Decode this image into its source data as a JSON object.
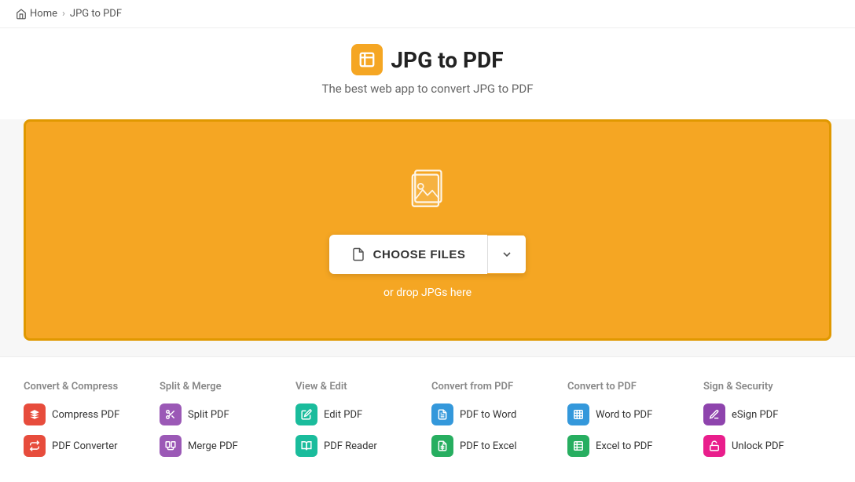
{
  "breadcrumb": {
    "home_label": "Home",
    "separator": "›",
    "current": "JPG to PDF"
  },
  "hero": {
    "title": "JPG to PDF",
    "subtitle": "The best web app to convert JPG to PDF",
    "app_icon": "⊞"
  },
  "dropzone": {
    "choose_files_label": "CHOOSE FILES",
    "drop_hint": "or drop JPGs here"
  },
  "tools": {
    "categories": [
      {
        "id": "convert-compress",
        "title": "Convert & Compress",
        "items": [
          {
            "id": "compress-pdf",
            "label": "Compress PDF",
            "icon_color": "icon-red",
            "icon": "🗜"
          },
          {
            "id": "pdf-converter",
            "label": "PDF Converter",
            "icon_color": "icon-red",
            "icon": "⇄"
          }
        ]
      },
      {
        "id": "split-merge",
        "title": "Split & Merge",
        "items": [
          {
            "id": "split-pdf",
            "label": "Split PDF",
            "icon_color": "icon-purple",
            "icon": "✂"
          },
          {
            "id": "merge-pdf",
            "label": "Merge PDF",
            "icon_color": "icon-purple",
            "icon": "⊕"
          }
        ]
      },
      {
        "id": "view-edit",
        "title": "View & Edit",
        "items": [
          {
            "id": "edit-pdf",
            "label": "Edit PDF",
            "icon_color": "icon-teal",
            "icon": "✎"
          },
          {
            "id": "pdf-reader",
            "label": "PDF Reader",
            "icon_color": "icon-teal",
            "icon": "📖"
          }
        ]
      },
      {
        "id": "convert-from-pdf",
        "title": "Convert from PDF",
        "items": [
          {
            "id": "pdf-to-word",
            "label": "PDF to Word",
            "icon_color": "icon-blue",
            "icon": "W"
          },
          {
            "id": "pdf-to-excel",
            "label": "PDF to Excel",
            "icon_color": "icon-green",
            "icon": "X"
          }
        ]
      },
      {
        "id": "convert-to-pdf",
        "title": "Convert to PDF",
        "items": [
          {
            "id": "word-to-pdf",
            "label": "Word to PDF",
            "icon_color": "icon-blue",
            "icon": "W"
          },
          {
            "id": "excel-to-pdf",
            "label": "Excel to PDF",
            "icon_color": "icon-green",
            "icon": "X"
          }
        ]
      },
      {
        "id": "sign-security",
        "title": "Sign & Security",
        "items": [
          {
            "id": "esign-pdf",
            "label": "eSign PDF",
            "icon_color": "icon-violet",
            "icon": "✍"
          },
          {
            "id": "unlock-pdf",
            "label": "Unlock PDF",
            "icon_color": "icon-pink",
            "icon": "🔓"
          }
        ]
      }
    ]
  }
}
